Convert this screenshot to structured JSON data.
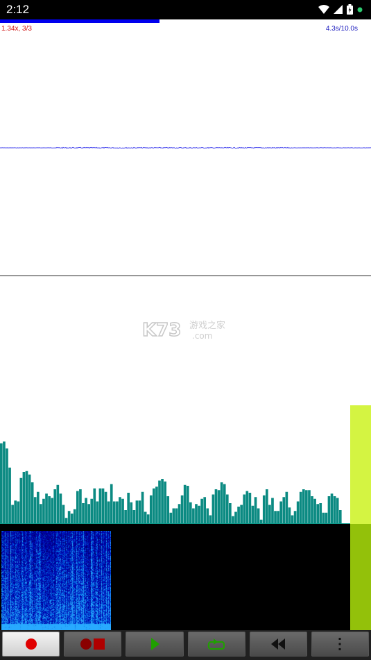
{
  "status_bar": {
    "time": "2:12"
  },
  "playback": {
    "progress_fraction": 0.43,
    "speed_label": "1.34x, 3/3",
    "time_label": "4.3s/10.0s"
  },
  "watermark": {
    "text": "K73 游戏之家 .com"
  },
  "spectrum_bars": [
    0.93,
    0.95,
    0.87,
    0.65,
    0.22,
    0.27,
    0.26,
    0.53,
    0.6,
    0.61,
    0.57,
    0.48,
    0.31,
    0.37,
    0.23,
    0.29,
    0.35,
    0.32,
    0.3,
    0.4,
    0.45,
    0.35,
    0.22,
    0.07,
    0.15,
    0.12,
    0.17,
    0.38,
    0.4,
    0.24,
    0.3,
    0.23,
    0.29,
    0.41,
    0.26,
    0.41,
    0.41,
    0.37,
    0.26,
    0.46,
    0.26,
    0.26,
    0.31,
    0.29,
    0.16,
    0.36,
    0.25,
    0.16,
    0.27,
    0.27,
    0.37,
    0.14,
    0.11,
    0.33,
    0.41,
    0.43,
    0.5,
    0.52,
    0.49,
    0.32,
    0.13,
    0.18,
    0.18,
    0.23,
    0.33,
    0.45,
    0.44,
    0.25,
    0.18,
    0.23,
    0.21,
    0.29,
    0.31,
    0.18,
    0.1,
    0.34,
    0.4,
    0.39,
    0.48,
    0.46,
    0.34,
    0.24,
    0.09,
    0.14,
    0.2,
    0.22,
    0.34,
    0.38,
    0.36,
    0.21,
    0.31,
    0.18,
    0.05,
    0.33,
    0.4,
    0.22,
    0.3,
    0.15,
    0.15,
    0.26,
    0.31,
    0.37,
    0.19,
    0.1,
    0.15,
    0.26,
    0.37,
    0.4,
    0.39,
    0.39,
    0.32,
    0.29,
    0.23,
    0.24,
    0.13,
    0.13,
    0.32,
    0.35,
    0.32,
    0.3,
    0.16
  ],
  "level_meter": {
    "peak_fraction": 0.53
  },
  "controls": [
    {
      "name": "record-button",
      "icon": "record-icon",
      "active": true
    },
    {
      "name": "record-stop-button",
      "icon": "record-stop-icon",
      "active": false
    },
    {
      "name": "play-button",
      "icon": "play-icon",
      "active": false
    },
    {
      "name": "loop-button",
      "icon": "loop-icon",
      "active": false
    },
    {
      "name": "rewind-button",
      "icon": "rewind-icon",
      "active": false
    },
    {
      "name": "menu-button",
      "icon": "more-vertical-icon",
      "active": false
    }
  ],
  "colors": {
    "progress": "#0000ee",
    "waveform": "#4a4aee",
    "spectrum_bar": "#0b8a82",
    "level_top": "#d4f442",
    "level_bottom": "#93c10a",
    "record_red": "#e00000",
    "play_green": "#1fa000"
  }
}
